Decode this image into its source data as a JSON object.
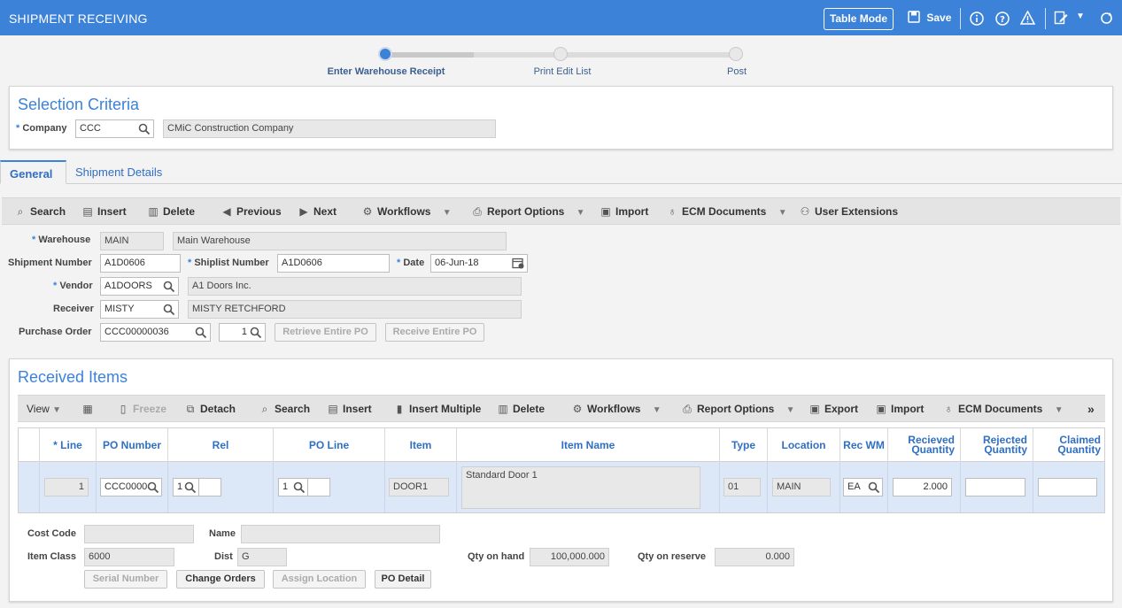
{
  "header": {
    "title": "SHIPMENT RECEIVING",
    "table_mode": "Table Mode",
    "save": "Save"
  },
  "steps": [
    "Enter Warehouse Receipt",
    "Print Edit List",
    "Post"
  ],
  "selection": {
    "title": "Selection Criteria",
    "company_label": "Company",
    "company_code": "CCC",
    "company_name": "CMiC Construction Company"
  },
  "tabs": [
    "General",
    "Shipment Details"
  ],
  "toolbar1": {
    "search": "Search",
    "insert": "Insert",
    "delete": "Delete",
    "previous": "Previous",
    "next": "Next",
    "workflows": "Workflows",
    "report_options": "Report Options",
    "import": "Import",
    "ecm": "ECM Documents",
    "user_ext": "User Extensions"
  },
  "form": {
    "warehouse_label": "Warehouse",
    "warehouse_code": "MAIN",
    "warehouse_name": "Main Warehouse",
    "shipment_label": "Shipment Number",
    "shipment_value": "A1D0606",
    "shiplist_label": "Shiplist Number",
    "shiplist_value": "A1D0606",
    "date_label": "Date",
    "date_value": "06-Jun-18",
    "vendor_label": "Vendor",
    "vendor_code": "A1DOORS",
    "vendor_name": "A1 Doors Inc.",
    "receiver_label": "Receiver",
    "receiver_code": "MISTY",
    "receiver_name": "MISTY RETCHFORD",
    "po_label": "Purchase Order",
    "po_value": "CCC00000036",
    "po_rel": "1",
    "retrieve_po": "Retrieve Entire PO",
    "receive_po": "Receive Entire PO"
  },
  "received": {
    "title": "Received Items",
    "toolbar": {
      "view": "View",
      "freeze": "Freeze",
      "detach": "Detach",
      "search": "Search",
      "insert": "Insert",
      "insert_multiple": "Insert Multiple",
      "delete": "Delete",
      "workflows": "Workflows",
      "report_options": "Report Options",
      "export": "Export",
      "import": "Import",
      "ecm": "ECM Documents"
    },
    "columns": {
      "line": "Line",
      "po_number": "PO Number",
      "rel": "Rel",
      "po_line": "PO Line",
      "item": "Item",
      "item_name": "Item Name",
      "type": "Type",
      "location": "Location",
      "rec_wm": "Rec WM",
      "received_qty": "Recieved Quantity",
      "rejected_qty": "Rejected Quantity",
      "claimed_qty": "Claimed Quantity"
    },
    "row": {
      "line": "1",
      "po_number": "CCC0000",
      "rel": "1",
      "po_line": "1",
      "item": "DOOR1",
      "item_name": "Standard Door 1",
      "type": "01",
      "location": "MAIN",
      "rec_wm": "EA",
      "received_qty": "2.000",
      "rejected_qty": "",
      "claimed_qty": ""
    }
  },
  "detail": {
    "cost_code_label": "Cost Code",
    "cost_code": "",
    "name_label": "Name",
    "name": "",
    "item_class_label": "Item Class",
    "item_class": "6000",
    "dist_label": "Dist",
    "dist": "G",
    "qty_on_hand_label": "Qty on hand",
    "qty_on_hand": "100,000.000",
    "qty_on_reserve_label": "Qty on reserve",
    "qty_on_reserve": "0.000",
    "serial_number": "Serial Number",
    "change_orders": "Change Orders",
    "assign_location": "Assign Location",
    "po_detail": "PO Detail"
  }
}
